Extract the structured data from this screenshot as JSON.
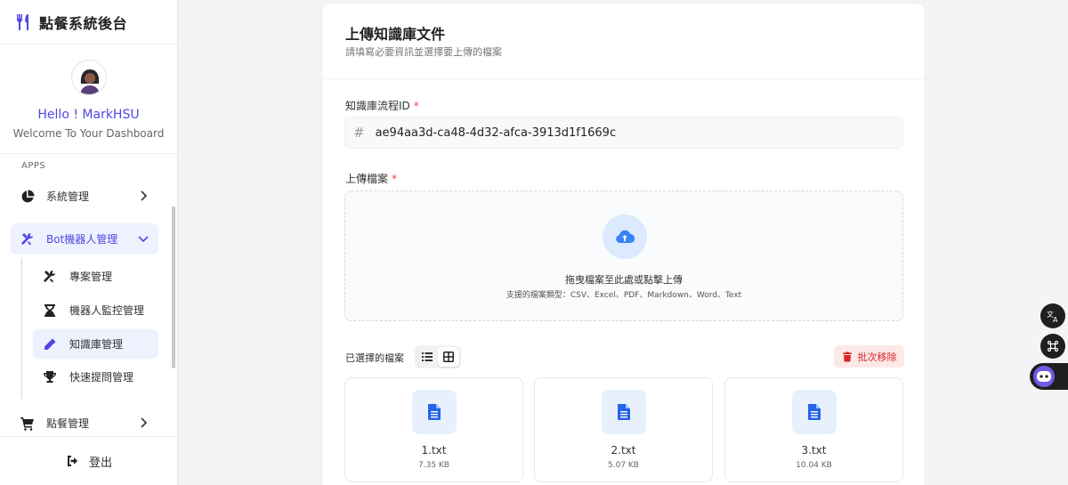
{
  "brand": {
    "title": "點餐系統後台",
    "logo_icon": "utensils-icon"
  },
  "profile": {
    "hello": "Hello ! MarkHSU",
    "welcome": "Welcome To Your Dashboard"
  },
  "nav": {
    "section": "APPS",
    "items": [
      {
        "label": "系統管理",
        "icon": "pie-chart-icon"
      },
      {
        "label": "Bot機器人管理",
        "icon": "tools-icon"
      },
      {
        "label": "點餐管理",
        "icon": "cart-icon"
      }
    ],
    "sub_items": [
      {
        "label": "專案管理",
        "icon": "tools-icon"
      },
      {
        "label": "機器人監控管理",
        "icon": "hourglass-icon"
      },
      {
        "label": "知識庫管理",
        "icon": "pencil-icon"
      },
      {
        "label": "快速提問管理",
        "icon": "trophy-icon"
      }
    ],
    "logout": "登出"
  },
  "page": {
    "title": "上傳知識庫文件",
    "subtitle": "請填寫必要資訊並選擇要上傳的檔案",
    "id_label": "知識庫流程ID",
    "id_value": "ae94aa3d-ca48-4d32-afca-3913d1f1669c",
    "upload_label": "上傳檔案",
    "required_mark": "*",
    "dropzone_main": "拖曳檔案至此處或點擊上傳",
    "dropzone_sub": "支援的檔案類型：CSV、Excel、PDF、Markdown、Word、Text",
    "selected_label": "已選擇的檔案",
    "batch_remove": "批次移除",
    "view_mode": "grid"
  },
  "files": [
    {
      "name": "1.txt",
      "size": "7.35 KB"
    },
    {
      "name": "2.txt",
      "size": "5.07 KB"
    },
    {
      "name": "3.txt",
      "size": "10.04 KB"
    }
  ],
  "colors": {
    "accent": "#4f46e5",
    "danger": "#dc2626",
    "file_blue": "#2563eb"
  }
}
